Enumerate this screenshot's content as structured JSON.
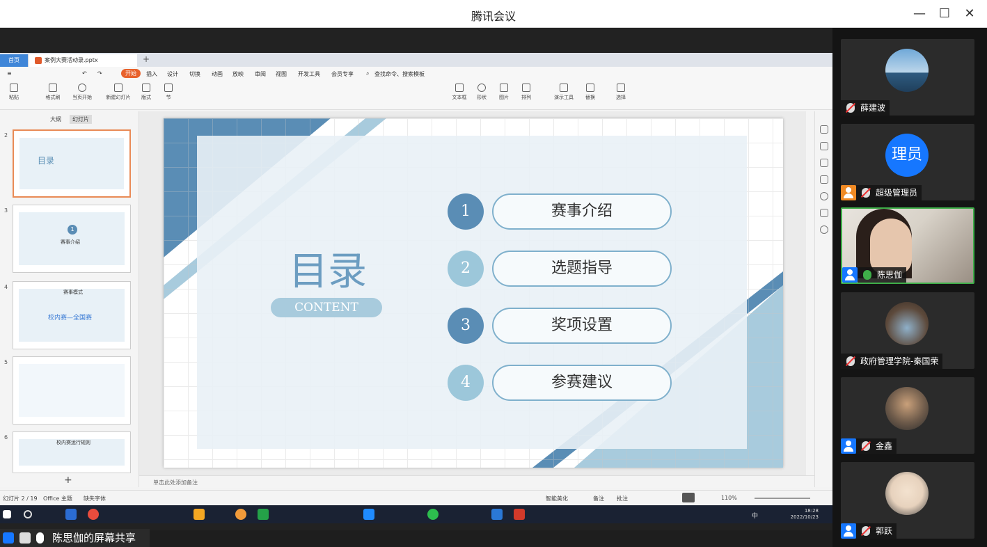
{
  "window": {
    "title": "腾讯会议",
    "min": "—",
    "max": "☐",
    "close": "✕"
  },
  "wps": {
    "home_tab": "首页",
    "file_tab": "案例大赛活动录.pptx",
    "menu": [
      "开始",
      "插入",
      "设计",
      "切换",
      "动画",
      "放映",
      "审阅",
      "视图",
      "开发工具",
      "会员专享"
    ],
    "active_menu": "开始",
    "search_placeholder": "查找命令、搜索模板",
    "ribbon_labels": [
      "粘贴",
      "格式刷",
      "当页开始",
      "新建幻灯片",
      "版式",
      "节",
      "文本框",
      "形状",
      "图片",
      "排列",
      "演示工具",
      "替换",
      "选择"
    ],
    "outline_tab": "大纲",
    "slides_tab": "幻灯片",
    "thumbs": [
      {
        "num": "2",
        "title": "目录"
      },
      {
        "num": "3",
        "title": "赛事介绍",
        "marker": "1"
      },
      {
        "num": "4",
        "title": "赛事模式",
        "sub": "校内赛—全国赛"
      },
      {
        "num": "5",
        "title": ""
      },
      {
        "num": "6",
        "title": "校内赛运行规则"
      }
    ],
    "add_slide": "+",
    "notes_placeholder": "单击此处添加备注",
    "status": {
      "slide_count": "幻灯片 2 / 19",
      "theme": "Office 主题",
      "font_missing": "缺失字体",
      "smart_beautify": "智能美化",
      "notes": "备注",
      "comments": "批注",
      "zoom": "110%"
    }
  },
  "slide": {
    "title": "目录",
    "subtitle": "CONTENT",
    "items": [
      {
        "num": "1",
        "label": "赛事介绍",
        "color": "#5a8db5"
      },
      {
        "num": "2",
        "label": "选题指导",
        "color": "#9cc7da"
      },
      {
        "num": "3",
        "label": "奖项设置",
        "color": "#5a8db5"
      },
      {
        "num": "4",
        "label": "参赛建议",
        "color": "#9cc7da"
      }
    ]
  },
  "taskbar": {
    "time": "18:28",
    "date": "2022/10/23",
    "ime": "中"
  },
  "share_label": "陈思伽的屏幕共享",
  "participants": [
    {
      "name": "薛建波",
      "avatar_icon": "landscape-avatar",
      "muted": true
    },
    {
      "name": "超级管理员",
      "avatar_text": "理员",
      "muted": true,
      "host": true
    },
    {
      "name": "陈思伽",
      "video": true,
      "muted": false
    },
    {
      "name": "政府管理学院-秦国荣",
      "avatar_icon": "heart-hands-avatar",
      "muted": true
    },
    {
      "name": "金鑫",
      "avatar_icon": "camera-avatar",
      "muted": true
    },
    {
      "name": "郭跃",
      "avatar_icon": "cartoon-avatar",
      "muted": true
    }
  ]
}
